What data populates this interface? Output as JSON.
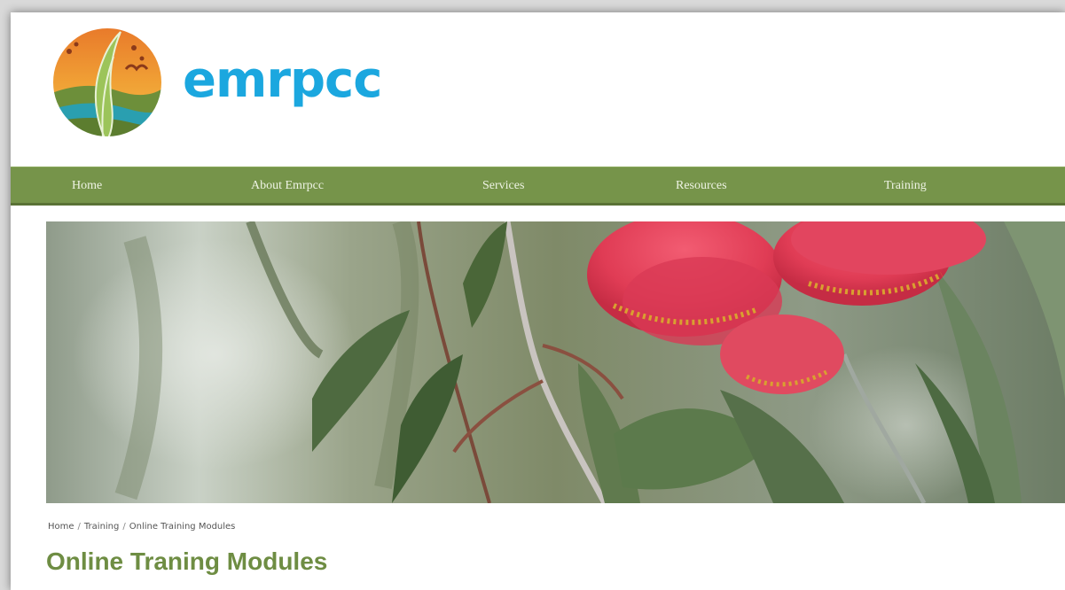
{
  "brand": {
    "name": "emrpcc",
    "primary_color": "#1ba7df",
    "accent_color": "#76944a"
  },
  "nav": {
    "items": [
      {
        "label": "Home"
      },
      {
        "label": "About Emrpcc"
      },
      {
        "label": "Services"
      },
      {
        "label": "Resources"
      },
      {
        "label": "Training"
      }
    ]
  },
  "hero": {
    "image": "eucalyptus-flower-icon"
  },
  "breadcrumb": {
    "items": [
      {
        "label": "Home"
      },
      {
        "label": "Training"
      },
      {
        "label": "Online Training Modules"
      }
    ],
    "separator": "/"
  },
  "page": {
    "title": "Online Traning Modules"
  }
}
